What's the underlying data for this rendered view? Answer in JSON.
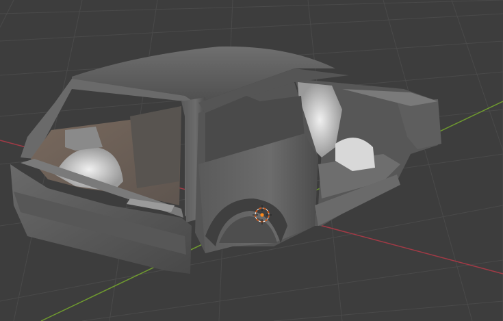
{
  "app": {
    "name": "",
    "view": "3D Viewport"
  },
  "viewport": {
    "background_color": "#3d3d3d",
    "grid_color": "#4a4a4a",
    "x_axis_color": "#a33a46",
    "y_axis_color": "#6f9a2f",
    "shading": "solid",
    "object": {
      "type": "mesh",
      "description_icon": "car-body-shell"
    },
    "cursor": {
      "icon": "3d-cursor-icon",
      "outer_color": "#c85a1e",
      "inner_color": "#ff8a1a"
    }
  },
  "ui_text": {}
}
